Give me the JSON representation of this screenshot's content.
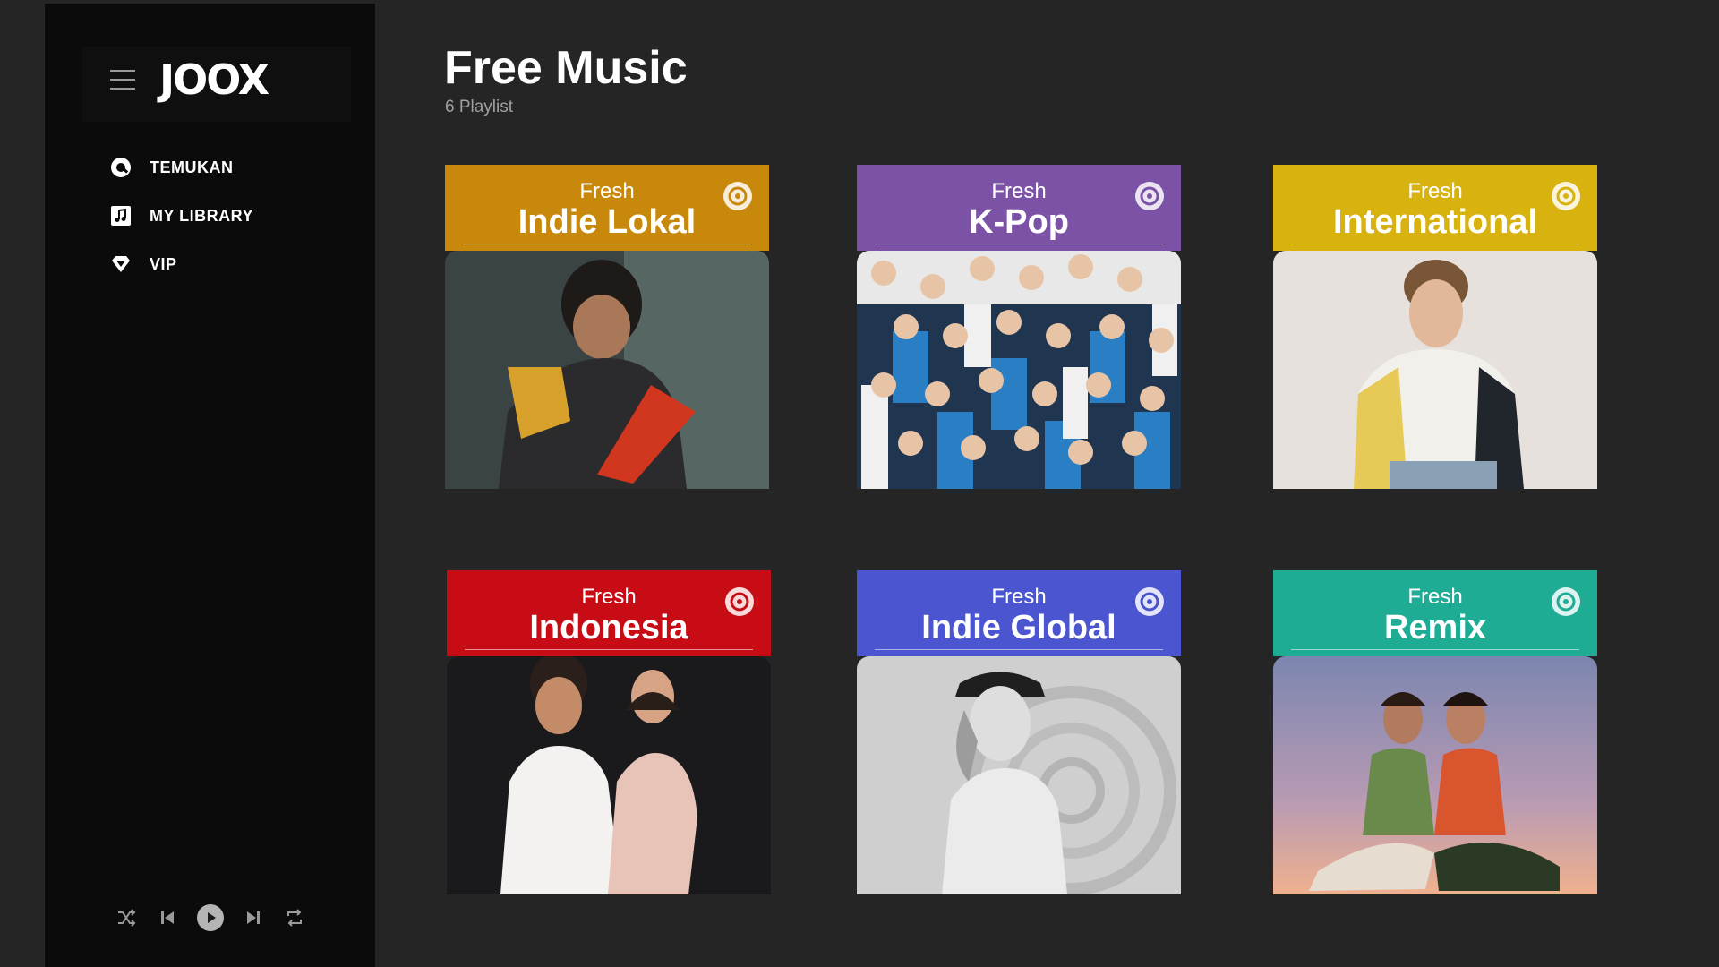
{
  "app": {
    "logo_text": "JOOX"
  },
  "sidebar": {
    "items": [
      {
        "label": "TEMUKAN",
        "icon": "discover-icon"
      },
      {
        "label": "MY LIBRARY",
        "icon": "music-library-icon"
      },
      {
        "label": "VIP",
        "icon": "vip-diamond-icon"
      }
    ]
  },
  "player": {
    "controls": [
      "shuffle-icon",
      "previous-icon",
      "play-icon",
      "next-icon",
      "repeat-icon"
    ]
  },
  "main": {
    "title": "Free Music",
    "subtitle": "6 Playlist"
  },
  "playlists": [
    {
      "prefix": "Fresh",
      "name": "Indie Lokal",
      "color": "#c8880b"
    },
    {
      "prefix": "Fresh",
      "name": "K-Pop",
      "color": "#7b52a6"
    },
    {
      "prefix": "Fresh",
      "name": "International",
      "color": "#d8b20f"
    },
    {
      "prefix": "Fresh",
      "name": "Indonesia",
      "color": "#c80c16"
    },
    {
      "prefix": "Fresh",
      "name": "Indie Global",
      "color": "#4a55cf"
    },
    {
      "prefix": "Fresh",
      "name": "Remix",
      "color": "#1eac94"
    }
  ]
}
